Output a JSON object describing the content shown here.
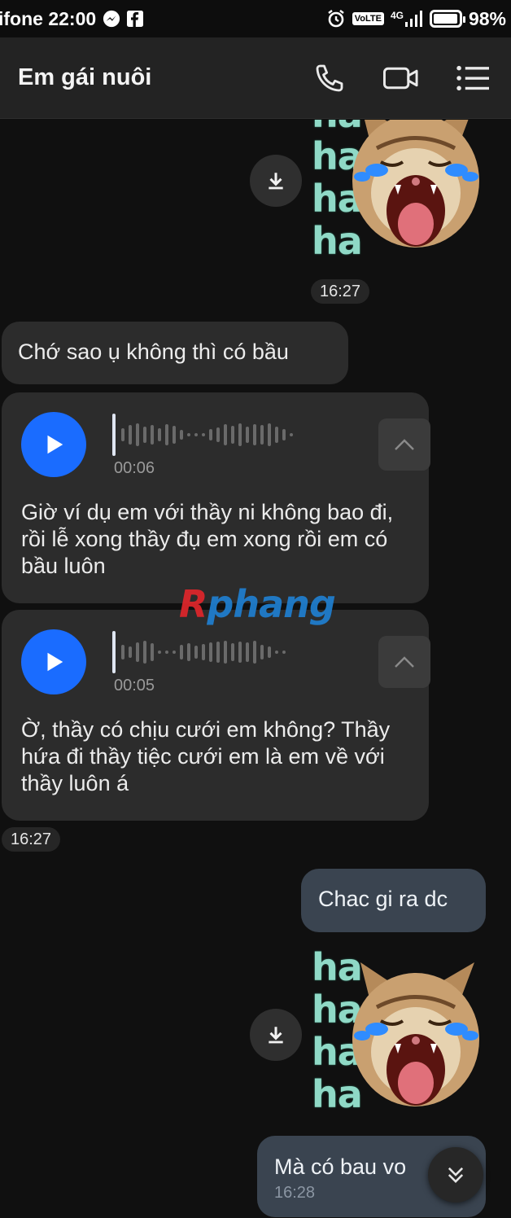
{
  "status_bar": {
    "carrier_time": "ifone 22:00",
    "battery": "98%",
    "battery_level": 0.98,
    "network_type": "4G",
    "volte": "VoLTE",
    "icons": [
      "messenger-icon",
      "facebook-icon",
      "alarm-icon",
      "volte-icon",
      "signal-icon",
      "battery-icon"
    ]
  },
  "header": {
    "contact_name": "Em gái nuôi",
    "actions": [
      "phone-icon",
      "video-call-icon",
      "menu-icon"
    ]
  },
  "messages": {
    "sticker_top": {
      "ha": [
        "ha",
        "ha",
        "ha",
        "ha"
      ]
    },
    "time_1": "16:27",
    "incoming_text": "Chớ sao ụ không thì có bầu",
    "voice_1": {
      "duration": "00:06",
      "transcript": "Giờ ví dụ em với thầy ni không bao đi, rồi lễ xong thầy đụ em xong rồi em có bầu luôn"
    },
    "voice_2": {
      "duration": "00:05",
      "transcript": "Ờ, thầy có chịu cưới em không? Thầy hứa đi thầy tiệc cưới em là em về với thầy luôn á"
    },
    "time_2": "16:27",
    "outgoing_1": "Chac gi ra dc",
    "sticker_bottom": {
      "ha": [
        "ha",
        "ha",
        "ha",
        "ha"
      ]
    },
    "outgoing_2": "Mà có bau vo",
    "outgoing_2_time": "16:28"
  },
  "watermark": {
    "r": "R",
    "rest": "phang"
  },
  "colors": {
    "accent_blue": "#1a6cff",
    "incoming_bubble": "#2c2c2c",
    "outgoing_bubble": "#3a4450",
    "background": "#101010"
  }
}
